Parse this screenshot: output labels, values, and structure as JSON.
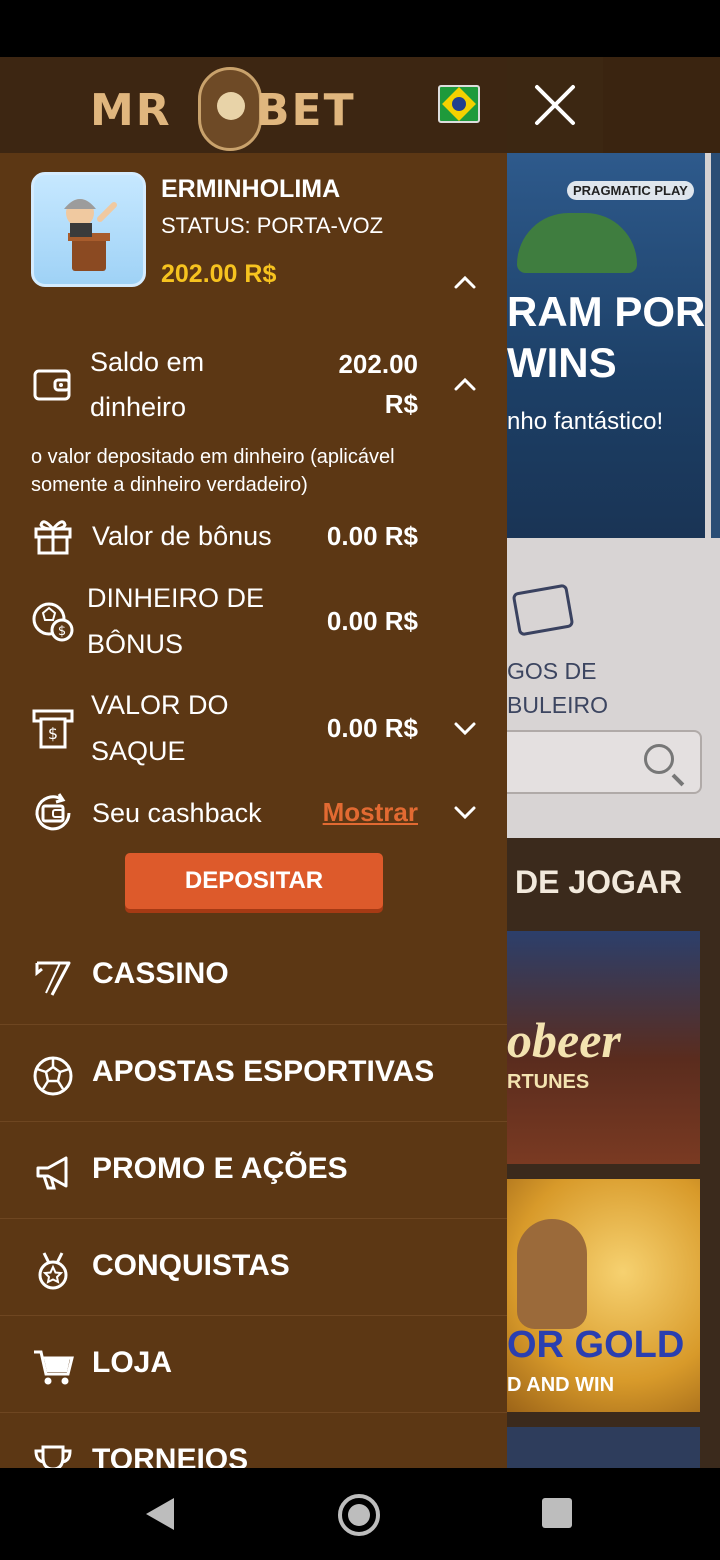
{
  "app": {
    "brand_left": "MR",
    "brand_right": "BET",
    "language_flag": "brazil-flag"
  },
  "user": {
    "username": "ERMINHOLIMA",
    "status": "STATUS: PORTA-VOZ",
    "balance": "202.00 R$"
  },
  "wallet": {
    "cash_label_line1": "Saldo em",
    "cash_label_line2": "dinheiro",
    "cash_value_line1": "202.00",
    "cash_value_line2": "R$",
    "cash_note": "o valor depositado em dinheiro (aplicável somente a dinheiro verdadeiro)",
    "bonus_value_label": "Valor de bônus",
    "bonus_value": "0.00 R$",
    "bonus_money_label_line1": "DINHEIRO DE",
    "bonus_money_label_line2": "BÔNUS",
    "bonus_money": "0.00 R$",
    "withdraw_label_line1": "VALOR DO",
    "withdraw_label_line2": "SAQUE",
    "withdraw_value": "0.00 R$",
    "cashback_label": "Seu cashback",
    "cashback_action": "Mostrar"
  },
  "deposit_button": "DEPOSITAR",
  "menu": [
    {
      "label": "CASSINO",
      "icon": "seven-icon"
    },
    {
      "label": "APOSTAS ESPORTIVAS",
      "icon": "soccer-ball-icon"
    },
    {
      "label": "PROMO E AÇÕES",
      "icon": "megaphone-icon"
    },
    {
      "label": "CONQUISTAS",
      "icon": "medal-icon"
    },
    {
      "label": "LOJA",
      "icon": "cart-icon"
    },
    {
      "label": "TORNEIOS",
      "icon": "trophy-icon"
    }
  ],
  "background": {
    "banner_provider": "PRAGMATIC PLAY",
    "banner_line1": "RAM POR",
    "banner_line2": "WINS",
    "banner_sub": "nho fantástico!",
    "category_line1": "GOS DE",
    "category_line2": "BULEIRO",
    "section_title": "DE JOGAR",
    "game1_title": "obeer",
    "game1_sub": "RTUNES",
    "game2_title": "OR GOLD",
    "game2_sub": "D AND WIN"
  },
  "colors": {
    "drawer_bg": "#5c3714",
    "header_bg": "#3d2612",
    "balance_yellow": "#f6c31f",
    "accent_orange": "#dd5a2b"
  }
}
